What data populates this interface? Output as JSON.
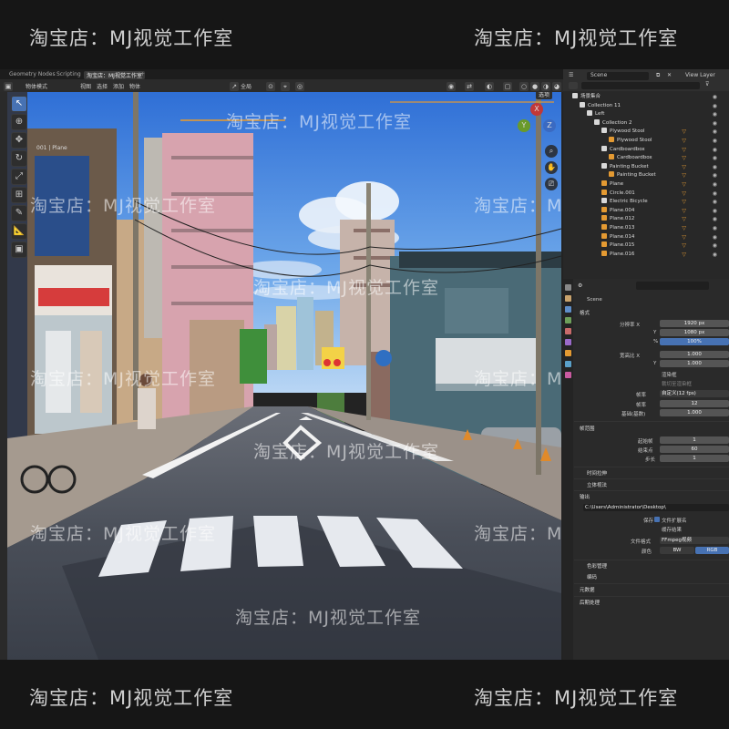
{
  "watermark": {
    "text": "淘宝店：MJ视觉工作室"
  },
  "tabs": [
    {
      "label": "Geometry Nodes"
    },
    {
      "label": "Scripting"
    },
    {
      "label": "淘宝店：MJ视觉工作室"
    }
  ],
  "header": {
    "mode": "物体模式",
    "menu": [
      "视图",
      "选择",
      "添加",
      "物体"
    ],
    "transform": "全局"
  },
  "viewport": {
    "object_label": "001 | Plane",
    "options_label": "选项"
  },
  "outliner": {
    "scene": "Scene",
    "view_layer": "View Layer",
    "items": [
      {
        "label": "场景集合",
        "indent": 0,
        "kind": "coll"
      },
      {
        "label": "Collection 11",
        "indent": 1,
        "kind": "coll"
      },
      {
        "label": "Left",
        "indent": 2,
        "kind": "coll"
      },
      {
        "label": "Collection 2",
        "indent": 3,
        "kind": "coll"
      },
      {
        "label": "Plywood Stool",
        "indent": 4,
        "kind": "coll"
      },
      {
        "label": "Plywood Stool",
        "indent": 5,
        "kind": "obj"
      },
      {
        "label": "Cardboardbox",
        "indent": 4,
        "kind": "coll"
      },
      {
        "label": "Cardboardbox",
        "indent": 5,
        "kind": "obj"
      },
      {
        "label": "Painting Bucket",
        "indent": 4,
        "kind": "coll"
      },
      {
        "label": "Painting Bucket",
        "indent": 5,
        "kind": "obj"
      },
      {
        "label": "Plane",
        "indent": 4,
        "kind": "mesh"
      },
      {
        "label": "Circle.001",
        "indent": 4,
        "kind": "mesh"
      },
      {
        "label": "Electric Bicycle",
        "indent": 4,
        "kind": "coll"
      },
      {
        "label": "Plane.004",
        "indent": 4,
        "kind": "mesh"
      },
      {
        "label": "Plane.012",
        "indent": 4,
        "kind": "mesh"
      },
      {
        "label": "Plane.013",
        "indent": 4,
        "kind": "mesh"
      },
      {
        "label": "Plane.014",
        "indent": 4,
        "kind": "mesh"
      },
      {
        "label": "Plane.015",
        "indent": 4,
        "kind": "mesh"
      },
      {
        "label": "Plane.016",
        "indent": 4,
        "kind": "mesh"
      }
    ]
  },
  "properties": {
    "scene": "Scene",
    "format_section": "格式",
    "res_x_label": "分辨率 X",
    "res_x": "1920 px",
    "res_y_label": "Y",
    "res_y": "1080 px",
    "res_pct_label": "%",
    "res_pct": "100%",
    "aspect_x_label": "宽高比 X",
    "aspect_x": "1.000",
    "aspect_y_label": "Y",
    "aspect_y": "1.000",
    "render_region": "渲染框",
    "crop": "裁切至渲染框",
    "fps_label": "帧率",
    "fps": "自定义(12 fps)",
    "fps2_label": "帧率",
    "fps2": "12",
    "base_label": "基础(基数)",
    "base": "1.000",
    "frame_range_section": "帧范围",
    "frame_start_label": "起始帧",
    "frame_start": "1",
    "frame_end_label": "结束点",
    "frame_end": "60",
    "frame_step_label": "步长",
    "frame_step": "1",
    "time_stretch": "时间拉伸",
    "stereoscopy": "立体视法",
    "output_section": "输出",
    "output_path": "C:\\Users\\Administrator\\Desktop\\",
    "save_label": "保存",
    "file_ext": "文件扩展名",
    "cache_result": "缓存结果",
    "file_format_label": "文件格式",
    "file_format": "FFmpeg视频",
    "color_label": "颜色",
    "color_bw": "BW",
    "color_rgb": "RGB",
    "color_mgmt": "色彩管理",
    "encoding": "编码",
    "metadata": "元数据",
    "postprocess": "后期处理"
  },
  "colors": {
    "accent": "#4772b3",
    "select": "#e49a32"
  }
}
